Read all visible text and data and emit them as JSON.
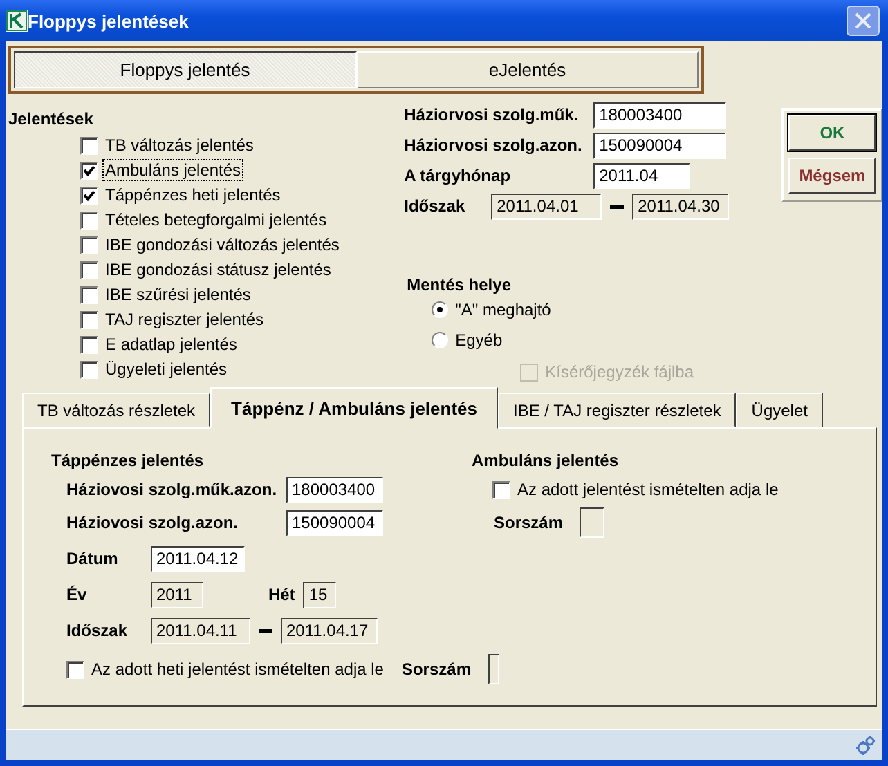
{
  "window": {
    "title": "Floppys jelentések"
  },
  "mode_tabs": [
    {
      "label": "Floppys jelentés",
      "selected": true
    },
    {
      "label": "eJelentés",
      "selected": false
    }
  ],
  "reports": {
    "title": "Jelentések",
    "items": [
      {
        "label": "TB változás jelentés",
        "checked": false,
        "focused": false
      },
      {
        "label": "Ambuláns jelentés",
        "checked": true,
        "focused": true
      },
      {
        "label": "Táppénzes heti jelentés",
        "checked": true,
        "focused": false
      },
      {
        "label": "Tételes betegforgalmi jelentés",
        "checked": false,
        "focused": false
      },
      {
        "label": "IBE gondozási változás jelentés",
        "checked": false,
        "focused": false
      },
      {
        "label": "IBE gondozási státusz jelentés",
        "checked": false,
        "focused": false
      },
      {
        "label": "IBE szűrési jelentés",
        "checked": false,
        "focused": false
      },
      {
        "label": "TAJ regiszter jelentés",
        "checked": false,
        "focused": false
      },
      {
        "label": "E adatlap jelentés",
        "checked": false,
        "focused": false
      },
      {
        "label": "Ügyeleti jelentés",
        "checked": false,
        "focused": false
      }
    ]
  },
  "header_fields": [
    {
      "label": "Háziorvosi szolg.műk.",
      "value": "180003400",
      "editable": true
    },
    {
      "label": "Háziorvosi szolg.azon.",
      "value": "150090004",
      "editable": true
    },
    {
      "label": "A tárgyhónap",
      "value": "2011.04",
      "editable": true
    }
  ],
  "period": {
    "label": "Időszak",
    "from": "2011.04.01",
    "to": "2011.04.30"
  },
  "buttons": [
    {
      "label": "OK",
      "kind": "ok"
    },
    {
      "label": "Mégsem",
      "kind": "cancel"
    }
  ],
  "save_location": {
    "title": "Mentés helye",
    "options": [
      {
        "label": "\"A\"  meghajtó",
        "selected": true
      },
      {
        "label": "Egyéb",
        "selected": false
      }
    ],
    "attachment": {
      "label": "Kísérőjegyzék fájlba",
      "checked": false,
      "disabled": true
    }
  },
  "detail_tabs": [
    {
      "label": "TB változás részletek",
      "selected": false
    },
    {
      "label": "Táppénz / Ambuláns jelentés",
      "selected": true
    },
    {
      "label": "IBE / TAJ regiszter részletek",
      "selected": false
    },
    {
      "label": "Ügyelet",
      "selected": false
    }
  ],
  "sick_pay": {
    "title": "Táppénzes jelentés",
    "fields": [
      {
        "label": "Háziovosi szolg.műk.azon.",
        "value": "180003400",
        "editable": true
      },
      {
        "label": "Háziovosi szolg.azon.",
        "value": "150090004",
        "editable": true
      }
    ],
    "date": {
      "label": "Dátum",
      "value": "2011.04.12",
      "editable": true
    },
    "year": {
      "label": "Év",
      "value": "2011",
      "editable": false
    },
    "week": {
      "label": "Hét",
      "value": "15",
      "editable": false
    },
    "period": {
      "label": "Időszak",
      "from": "2011.04.11",
      "to": "2011.04.17"
    },
    "repeat": {
      "label": "Az adott heti jelentést ismételten adja le",
      "checked": false
    },
    "serial": {
      "label": "Sorszám"
    }
  },
  "outpatient": {
    "title": "Ambuláns jelentés",
    "repeat": {
      "label": "Az adott jelentést ismételten adja le",
      "checked": false
    },
    "serial": {
      "label": "Sorszám"
    }
  }
}
